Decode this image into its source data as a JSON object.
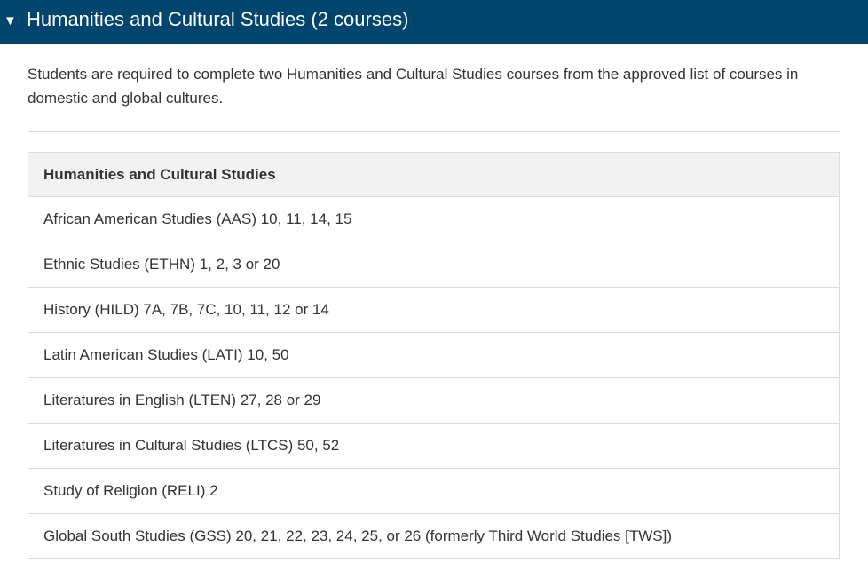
{
  "section": {
    "toggle_icon": "▼",
    "toggle_icon_name": "triangle-down-icon",
    "title": "Humanities and Cultural Studies (2 courses)",
    "header_color": "#00456e"
  },
  "intro": "Students are required to complete two Humanities and Cultural Studies courses from the approved list of courses in domestic and global cultures.",
  "table": {
    "header": "Humanities and Cultural Studies",
    "rows": [
      "African American Studies (AAS) 10, 11, 14, 15",
      "Ethnic Studies (ETHN) 1, 2, 3 or 20",
      "History (HILD) 7A, 7B, 7C, 10, 11, 12 or 14",
      "Latin American Studies (LATI) 10, 50",
      "Literatures in English (LTEN) 27, 28 or 29",
      "Literatures in Cultural Studies (LTCS) 50, 52",
      "Study of Religion (RELI) 2",
      "Global South Studies (GSS) 20, 21, 22, 23, 24, 25, or 26 (formerly Third World Studies [TWS])"
    ]
  }
}
